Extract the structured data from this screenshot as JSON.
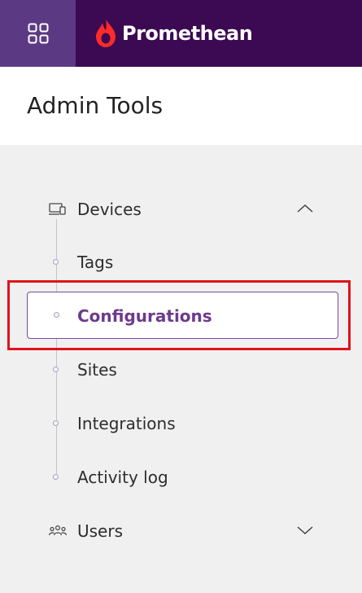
{
  "brand": {
    "name": "Promethean",
    "accent": "#3b0a52",
    "apps_button_bg": "#5b3a83"
  },
  "header": {
    "title": "Admin Tools"
  },
  "nav": {
    "devices": {
      "label": "Devices",
      "icon": "devices-icon",
      "expanded": true
    },
    "sub_items": [
      {
        "label": "Tags"
      },
      {
        "label": "Configurations",
        "active": true
      },
      {
        "label": "Sites"
      },
      {
        "label": "Integrations"
      },
      {
        "label": "Activity log"
      }
    ],
    "users": {
      "label": "Users",
      "icon": "users-icon",
      "expanded": false
    }
  },
  "colors": {
    "active_text": "#6c3b8c",
    "highlight": "#e1121a"
  }
}
